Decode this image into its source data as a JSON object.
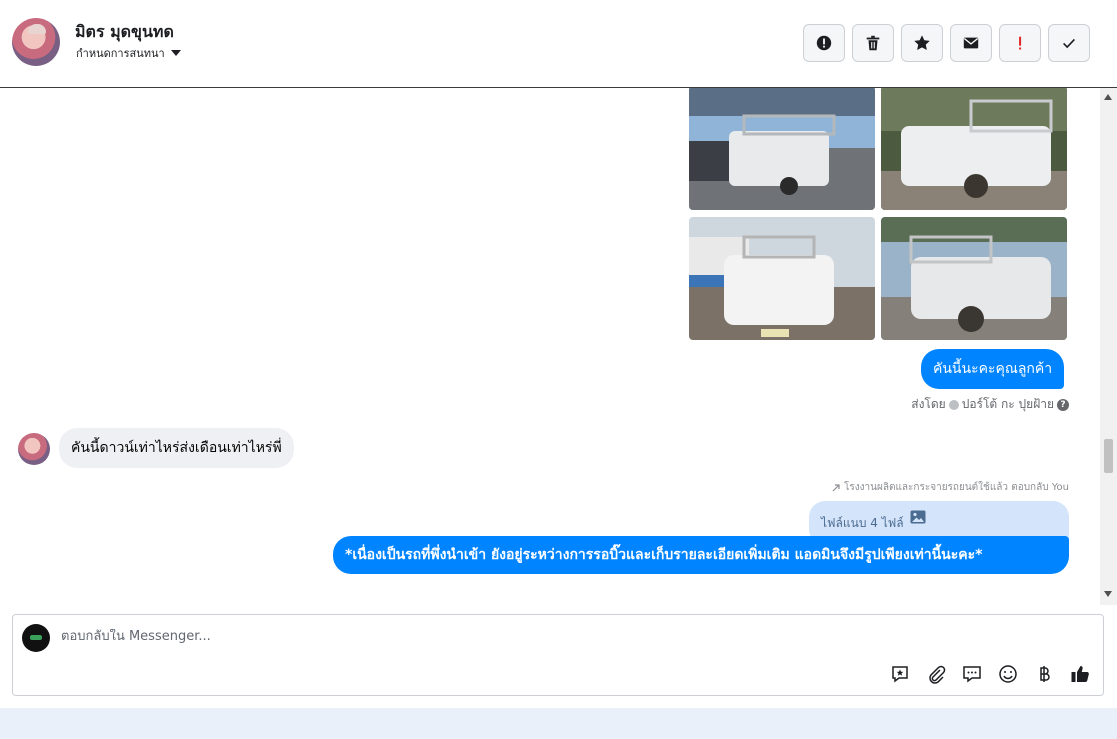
{
  "header": {
    "contact_name": "มิตร มุดขุนทด",
    "conversation_settings": "กำหนดการสนทนา",
    "toolbar": [
      {
        "name": "spam-button",
        "icon": "alert-circle-icon"
      },
      {
        "name": "delete-button",
        "icon": "trash-icon"
      },
      {
        "name": "star-button",
        "icon": "star-icon"
      },
      {
        "name": "mark-unread-button",
        "icon": "envelope-icon"
      },
      {
        "name": "important-button",
        "icon": "exclamation-icon"
      },
      {
        "name": "done-button",
        "icon": "checkmark-icon"
      }
    ]
  },
  "messages": {
    "photo_grid_count": 4,
    "outgoing_1": "คันนี้นะคะคุณลูกค้า",
    "sent_by_prefix": "ส่งโดย",
    "sent_by_name": "ปอร์โต้ กะ ปุยฝ้าย",
    "incoming_1": "คันนี้ดาวน์เท่าไหร่ส่งเดือนเท่าไหร่พี่",
    "reply_note": "โรงงานผลิตและกระจายรถยนต์ใช้แล้ว ตอบกลับ You",
    "attachment_label": "ไฟล์แนบ 4 ไฟล์",
    "outgoing_2": "*เนื่องเป็นรถที่พึ่งนำเข้า ยังอยู่ระหว่างการรอบิ๊วและเก็บรายละเอียดเพิ่มเติม แอดมินจึงมีรูปเพียงเท่านี้นะคะ*"
  },
  "composer": {
    "placeholder": "ตอบกลับใน Messenger...",
    "tools": [
      "saved-reply-icon",
      "paperclip-icon",
      "chat-bubble-icon",
      "emoji-icon",
      "baht-icon",
      "thumbs-up-icon"
    ]
  },
  "colors": {
    "messenger_blue": "#0084ff",
    "incoming_bubble": "#eff0f3",
    "attachment_bubble": "#d4e5fb",
    "important_red": "#e02424"
  }
}
